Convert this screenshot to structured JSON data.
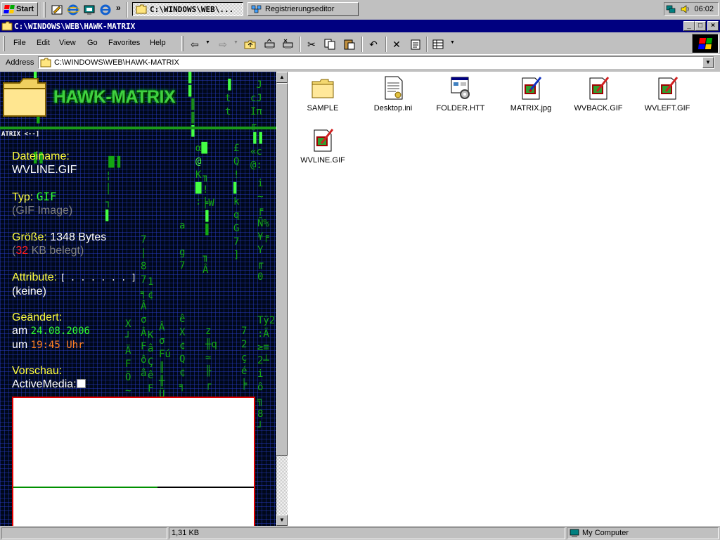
{
  "taskbar": {
    "start_label": "Start",
    "tasks": [
      "C:\\WINDOWS\\WEB\\...",
      "Registrierungseditor"
    ],
    "clock": "06:02",
    "overflow_glyph": "»"
  },
  "window": {
    "title": "C:\\WINDOWS\\WEB\\HAWK-MATRIX",
    "min": "_",
    "max": "□",
    "close": "×"
  },
  "menu": [
    "File",
    "Edit",
    "View",
    "Go",
    "Favorites",
    "Help"
  ],
  "toolbar_icons": [
    "back-icon",
    "forward-icon",
    "up-icon",
    "map-drive-icon",
    "disconnect-icon",
    "cut-icon",
    "copy-icon",
    "paste-icon",
    "undo-icon",
    "delete-icon",
    "properties-icon",
    "views-icon"
  ],
  "address": {
    "label": "Address",
    "value": "C:\\WINDOWS\\WEB\\HAWK-MATRIX"
  },
  "panel": {
    "title": "HAWK-MATRIX",
    "ticker": "ATRIX <--]",
    "filename_label": "Dateiname:",
    "filename": "WVLINE.GIF",
    "type_label": "Typ:",
    "type_value": "GIF",
    "type_desc": "(GIF Image)",
    "size_label": "Größe:",
    "size_value": "1348 Bytes",
    "size_open": "(",
    "size_kb": "32",
    "size_rest": " KB belegt)",
    "attr_label": "Attribute:",
    "attr_value": "[ . . . . . . ]",
    "attr_desc": "(keine)",
    "changed_label": "Geändert:",
    "date_prefix": "am ",
    "date": "24.08.2006",
    "time_prefix": "um ",
    "time": "19:45 Uhr",
    "preview_label": "Vorschau:",
    "activemedia_label": "ActiveMedia:"
  },
  "files": [
    {
      "name": "SAMPLE",
      "icon": "folder-icon"
    },
    {
      "name": "Desktop.ini",
      "icon": "ini-file-icon"
    },
    {
      "name": "FOLDER.HTT",
      "icon": "htt-file-icon"
    },
    {
      "name": "MATRIX.jpg",
      "icon": "image-file-icon"
    },
    {
      "name": "WVBACK.GIF",
      "icon": "image-file-icon"
    },
    {
      "name": "WVLEFT.GIF",
      "icon": "image-file-icon"
    },
    {
      "name": "WVLINE.GIF",
      "icon": "image-file-icon"
    }
  ],
  "status": {
    "size": "1,31 KB",
    "location": "My Computer"
  },
  "colors": {
    "titlebar": "#000080",
    "matrix_green": "#14a814",
    "label_yellow": "#ffff40",
    "preview_border": "#e00000"
  }
}
